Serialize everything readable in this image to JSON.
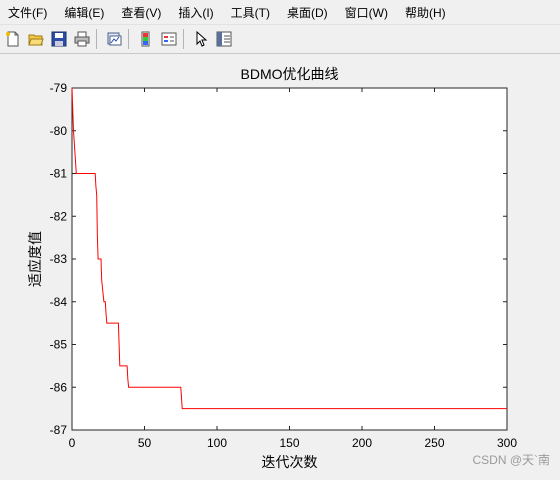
{
  "menubar": {
    "items": [
      {
        "label": "文件(F)"
      },
      {
        "label": "编辑(E)"
      },
      {
        "label": "查看(V)"
      },
      {
        "label": "插入(I)"
      },
      {
        "label": "工具(T)"
      },
      {
        "label": "桌面(D)"
      },
      {
        "label": "窗口(W)"
      },
      {
        "label": "帮助(H)"
      }
    ]
  },
  "toolbar": {
    "icons": [
      "new-file-icon",
      "open-folder-icon",
      "save-icon",
      "print-icon",
      "print-figure-icon",
      "colorbar-icon",
      "legend-icon",
      "pointer-icon",
      "property-editor-icon"
    ]
  },
  "chart_data": {
    "type": "line",
    "title": "BDMO优化曲线",
    "xlabel": "迭代次数",
    "ylabel": "适应度值",
    "xlim": [
      0,
      300
    ],
    "ylim": [
      -87,
      -79
    ],
    "xticks": [
      "0",
      "50",
      "100",
      "150",
      "200",
      "250",
      "300"
    ],
    "yticks": [
      "-79",
      "-80",
      "-81",
      "-82",
      "-83",
      "-84",
      "-85",
      "-86",
      "-87"
    ],
    "grid": false,
    "series": [
      {
        "color": "#ff0000",
        "x": [
          0,
          1,
          2,
          3,
          16,
          16.5,
          17,
          17.5,
          18,
          20,
          20.5,
          22,
          23,
          23.5,
          24,
          32,
          32.5,
          33,
          38,
          38.5,
          39,
          40,
          75,
          76,
          300
        ],
        "y": [
          -79,
          -80,
          -80.5,
          -81,
          -81,
          -81.3,
          -81.5,
          -82.5,
          -83,
          -83,
          -83.5,
          -84,
          -84,
          -84.3,
          -84.5,
          -84.5,
          -85,
          -85.5,
          -85.5,
          -85.8,
          -86,
          -86,
          -86,
          -86.5,
          -86.5
        ]
      }
    ]
  },
  "watermark": "CSDN @天`南"
}
